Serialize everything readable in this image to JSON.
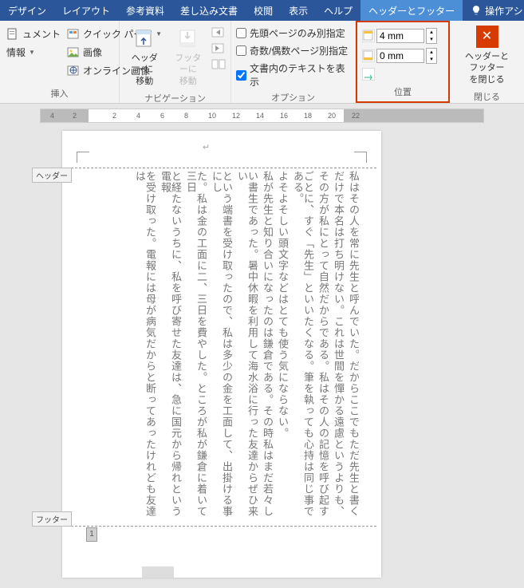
{
  "tabs": {
    "design": "デザイン",
    "layout": "レイアウト",
    "ref": "参考資料",
    "mail": "差し込み文書",
    "review": "校閲",
    "view": "表示",
    "help": "ヘルプ",
    "hf": "ヘッダーとフッター",
    "search": "操作アシ"
  },
  "insert": {
    "quick": "クイック パーツ",
    "image": "画像",
    "doc": "ュメント",
    "info": "情報",
    "online": "オンライン画像",
    "label": "挿入"
  },
  "nav": {
    "to_header": "ヘッダーに\n移動",
    "to_footer": "フッターに\n移動",
    "label": "ナビゲーション"
  },
  "opt": {
    "first": "先頭ページのみ別指定",
    "odd": "奇数/偶数ページ別指定",
    "show": "文書内のテキストを表示",
    "label": "オプション"
  },
  "pos": {
    "top": "4 mm",
    "bottom": "0 mm",
    "label": "位置"
  },
  "close": {
    "l1": "ヘッダーとフッター",
    "l2": "を閉じる",
    "label": "閉じる"
  },
  "ruler": [
    "4",
    "2",
    "2",
    "4",
    "6",
    "8",
    "10",
    "12",
    "14",
    "16",
    "18",
    "20",
    "22"
  ],
  "tags": {
    "header": "ヘッダー",
    "footer": "フッター"
  },
  "body": [
    "私はその人を常に先生と呼んでいた。だからここでもただ先生と書く",
    "だけで本名は打ち明けない。これは世間を憚かる遠慮というよりも、",
    "その方が私にとって自然だからである。私はその人の記憶を呼び起す",
    "ごとに、すぐ「先生」といいたくなる。筆を執っても心持は同じ事である。",
    "よそよそしい頭文字などはとても使う気にならない。",
    "私が先生と知り合いになったのは鎌倉である。その時私はまだ若々し",
    "い書生であった。暑中休暇を利用して海水浴に行った友達からぜひ来い",
    "という端書を受け取ったので、私は多少の金を工面して、出掛ける事にし",
    "た。私は金の工面に二、三日を費やした。ところが私が鎌倉に着いて三日",
    "と経たないうちに、私を呼び寄せた友達は、急に国元から帰れという電報",
    "を受け取った。電報には母が病気だからと断ってあったけれども友達は"
  ],
  "footer_num": "1"
}
